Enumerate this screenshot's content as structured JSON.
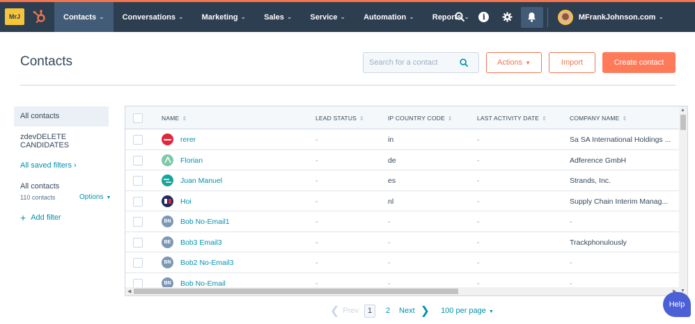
{
  "nav": {
    "brand_logo_text": "MrJ",
    "items": [
      {
        "label": "Contacts",
        "active": true
      },
      {
        "label": "Conversations"
      },
      {
        "label": "Marketing"
      },
      {
        "label": "Sales"
      },
      {
        "label": "Service"
      },
      {
        "label": "Automation"
      },
      {
        "label": "Reports"
      }
    ],
    "account_name": "MFrankJohnson.com",
    "accent_color": "#f2754e",
    "bg_color": "#2d3e50"
  },
  "header": {
    "title": "Contacts",
    "search_placeholder": "Search for a contact",
    "actions_label": "Actions",
    "import_label": "Import",
    "create_label": "Create contact"
  },
  "sidebar": {
    "active_view": "All contacts",
    "view_2": "zdevDELETE CANDIDATES",
    "saved_filters_label": "All saved filters",
    "filter_title": "All contacts",
    "filter_count": "110 contacts",
    "options_label": "Options",
    "add_filter_label": "Add filter"
  },
  "table": {
    "columns": [
      "NAME",
      "LEAD STATUS",
      "IP COUNTRY CODE",
      "LAST ACTIVITY DATE",
      "COMPANY NAME"
    ],
    "rows": [
      {
        "avatar": "logo-red",
        "initials": "",
        "name": "rerer",
        "lead_status": "-",
        "ip_country": "in",
        "last_activity": "-",
        "company": "Sa SA International Holdings ..."
      },
      {
        "avatar": "logo-green",
        "initials": "",
        "name": "Florian",
        "lead_status": "-",
        "ip_country": "de",
        "last_activity": "-",
        "company": "Adference GmbH"
      },
      {
        "avatar": "logo-teal",
        "initials": "",
        "name": "Juan Manuel",
        "lead_status": "-",
        "ip_country": "es",
        "last_activity": "-",
        "company": "Strands, Inc."
      },
      {
        "avatar": "logo-navy",
        "initials": "",
        "name": "Hoi",
        "lead_status": "-",
        "ip_country": "nl",
        "last_activity": "-",
        "company": "Supply Chain Interim Manag..."
      },
      {
        "avatar": "initials",
        "initials": "BN",
        "name": "Bob No-Email1",
        "lead_status": "-",
        "ip_country": "-",
        "last_activity": "-",
        "company": "-"
      },
      {
        "avatar": "initials",
        "initials": "BE",
        "name": "Bob3 Email3",
        "lead_status": "-",
        "ip_country": "-",
        "last_activity": "-",
        "company": "Trackphonulously"
      },
      {
        "avatar": "initials",
        "initials": "BN",
        "name": "Bob2 No-Email3",
        "lead_status": "-",
        "ip_country": "-",
        "last_activity": "-",
        "company": "-"
      },
      {
        "avatar": "initials",
        "initials": "BN",
        "name": "Bob No-Email",
        "lead_status": "-",
        "ip_country": "-",
        "last_activity": "-",
        "company": "-"
      }
    ]
  },
  "pagination": {
    "prev_label": "Prev",
    "current_page": "1",
    "next_page": "2",
    "next_label": "Next",
    "per_page_label": "100 per page"
  },
  "help_label": "Help"
}
